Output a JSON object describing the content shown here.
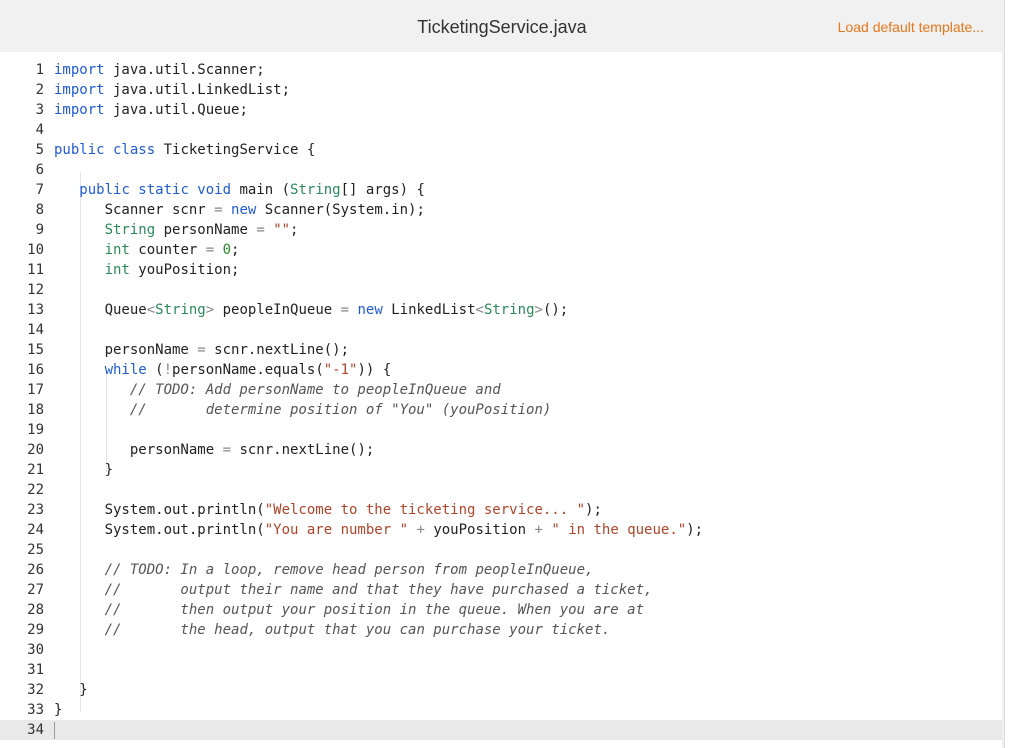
{
  "header": {
    "file_name": "TicketingService.java",
    "load_template_label": "Load default template..."
  },
  "editor": {
    "active_line": 34,
    "lines": [
      {
        "n": "1",
        "segs": [
          [
            "kw",
            "import"
          ],
          [
            "t",
            " java.util.Scanner;"
          ]
        ]
      },
      {
        "n": "2",
        "segs": [
          [
            "kw",
            "import"
          ],
          [
            "t",
            " java.util.LinkedList;"
          ]
        ]
      },
      {
        "n": "3",
        "segs": [
          [
            "kw",
            "import"
          ],
          [
            "t",
            " java.util.Queue;"
          ]
        ]
      },
      {
        "n": "4",
        "segs": []
      },
      {
        "n": "5",
        "segs": [
          [
            "kw",
            "public class"
          ],
          [
            "t",
            " TicketingService {"
          ]
        ]
      },
      {
        "n": "6",
        "segs": []
      },
      {
        "n": "7",
        "segs": [
          [
            "t",
            "   "
          ],
          [
            "kw",
            "public static void"
          ],
          [
            "t",
            " main ("
          ],
          [
            "ty",
            "String"
          ],
          [
            "t",
            "[] args) {"
          ]
        ]
      },
      {
        "n": "8",
        "segs": [
          [
            "t",
            "      Scanner scnr "
          ],
          [
            "op",
            "="
          ],
          [
            "t",
            " "
          ],
          [
            "kw",
            "new"
          ],
          [
            "t",
            " Scanner(System.in);"
          ]
        ]
      },
      {
        "n": "9",
        "segs": [
          [
            "t",
            "      "
          ],
          [
            "ty",
            "String"
          ],
          [
            "t",
            " personName "
          ],
          [
            "op",
            "="
          ],
          [
            "t",
            " "
          ],
          [
            "str",
            "\"\""
          ],
          [
            "t",
            ";"
          ]
        ]
      },
      {
        "n": "10",
        "segs": [
          [
            "t",
            "      "
          ],
          [
            "ty",
            "int"
          ],
          [
            "t",
            " counter "
          ],
          [
            "op",
            "="
          ],
          [
            "t",
            " "
          ],
          [
            "num",
            "0"
          ],
          [
            "t",
            ";"
          ]
        ]
      },
      {
        "n": "11",
        "segs": [
          [
            "t",
            "      "
          ],
          [
            "ty",
            "int"
          ],
          [
            "t",
            " youPosition;"
          ]
        ]
      },
      {
        "n": "12",
        "segs": []
      },
      {
        "n": "13",
        "segs": [
          [
            "t",
            "      Queue"
          ],
          [
            "op",
            "<"
          ],
          [
            "ty",
            "String"
          ],
          [
            "op",
            ">"
          ],
          [
            "t",
            " peopleInQueue "
          ],
          [
            "op",
            "="
          ],
          [
            "t",
            " "
          ],
          [
            "kw",
            "new"
          ],
          [
            "t",
            " LinkedList"
          ],
          [
            "op",
            "<"
          ],
          [
            "ty",
            "String"
          ],
          [
            "op",
            ">"
          ],
          [
            "t",
            "();"
          ]
        ]
      },
      {
        "n": "14",
        "segs": []
      },
      {
        "n": "15",
        "segs": [
          [
            "t",
            "      personName "
          ],
          [
            "op",
            "="
          ],
          [
            "t",
            " scnr.nextLine();"
          ]
        ]
      },
      {
        "n": "16",
        "segs": [
          [
            "t",
            "      "
          ],
          [
            "kw",
            "while"
          ],
          [
            "t",
            " ("
          ],
          [
            "op",
            "!"
          ],
          [
            "t",
            "personName.equals("
          ],
          [
            "str",
            "\"-1\""
          ],
          [
            "t",
            ")) {"
          ]
        ]
      },
      {
        "n": "17",
        "segs": [
          [
            "t",
            "         "
          ],
          [
            "cm",
            "// TODO: Add personName to peopleInQueue and"
          ]
        ]
      },
      {
        "n": "18",
        "segs": [
          [
            "t",
            "         "
          ],
          [
            "cm",
            "//       determine position of \"You\" (youPosition)"
          ]
        ]
      },
      {
        "n": "19",
        "segs": []
      },
      {
        "n": "20",
        "segs": [
          [
            "t",
            "         personName "
          ],
          [
            "op",
            "="
          ],
          [
            "t",
            " scnr.nextLine();"
          ]
        ]
      },
      {
        "n": "21",
        "segs": [
          [
            "t",
            "      }"
          ]
        ]
      },
      {
        "n": "22",
        "segs": []
      },
      {
        "n": "23",
        "segs": [
          [
            "t",
            "      System.out.println("
          ],
          [
            "str",
            "\"Welcome to the ticketing service... \""
          ],
          [
            "t",
            ");"
          ]
        ]
      },
      {
        "n": "24",
        "segs": [
          [
            "t",
            "      System.out.println("
          ],
          [
            "str",
            "\"You are number \""
          ],
          [
            "t",
            " "
          ],
          [
            "op",
            "+"
          ],
          [
            "t",
            " youPosition "
          ],
          [
            "op",
            "+"
          ],
          [
            "t",
            " "
          ],
          [
            "str",
            "\" in the queue.\""
          ],
          [
            "t",
            ");"
          ]
        ]
      },
      {
        "n": "25",
        "segs": []
      },
      {
        "n": "26",
        "segs": [
          [
            "t",
            "      "
          ],
          [
            "cm",
            "// TODO: In a loop, remove head person from peopleInQueue,"
          ]
        ]
      },
      {
        "n": "27",
        "segs": [
          [
            "t",
            "      "
          ],
          [
            "cm",
            "//       output their name and that they have purchased a ticket,"
          ]
        ]
      },
      {
        "n": "28",
        "segs": [
          [
            "t",
            "      "
          ],
          [
            "cm",
            "//       then output your position in the queue. When you are at"
          ]
        ]
      },
      {
        "n": "29",
        "segs": [
          [
            "t",
            "      "
          ],
          [
            "cm",
            "//       the head, output that you can purchase your ticket."
          ]
        ]
      },
      {
        "n": "30",
        "segs": []
      },
      {
        "n": "31",
        "segs": []
      },
      {
        "n": "32",
        "segs": [
          [
            "t",
            "   }"
          ]
        ]
      },
      {
        "n": "33",
        "segs": [
          [
            "t",
            "}"
          ]
        ]
      },
      {
        "n": "34",
        "segs": []
      }
    ]
  }
}
